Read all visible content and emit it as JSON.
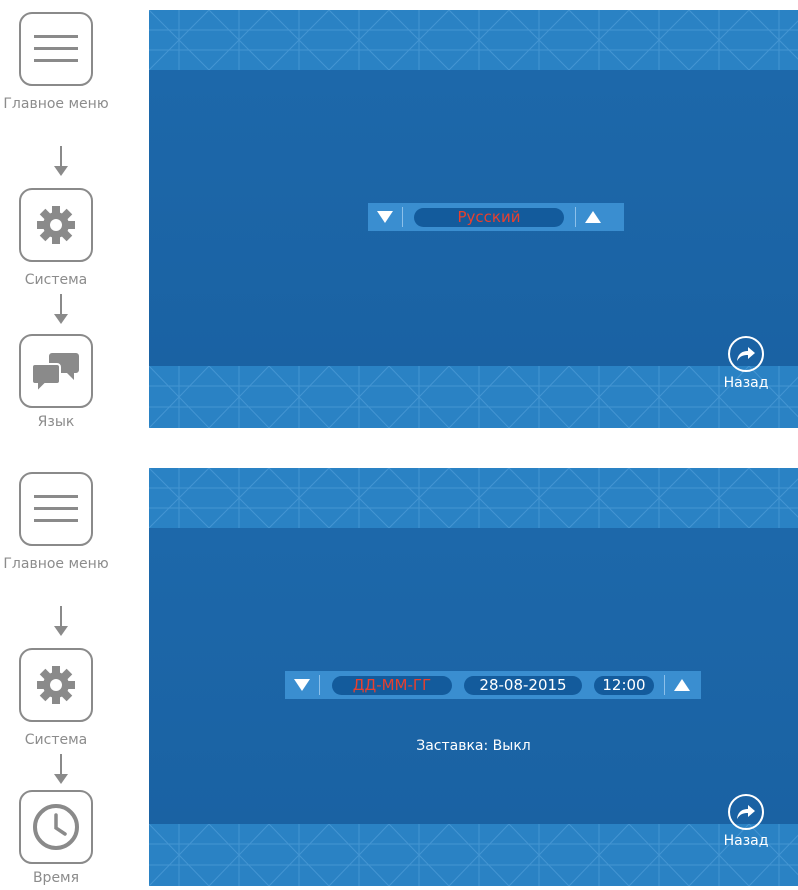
{
  "panels": [
    {
      "nav": [
        {
          "icon": "menu-icon",
          "label": "Главное меню"
        },
        {
          "icon": "gear-icon",
          "label": "Система"
        },
        {
          "icon": "chat-icon",
          "label": "Язык"
        }
      ],
      "screen": {
        "options": [
          {
            "text": "Русский",
            "active": true
          }
        ],
        "status": "",
        "back_label": "Назад"
      }
    },
    {
      "nav": [
        {
          "icon": "menu-icon",
          "label": "Главное меню"
        },
        {
          "icon": "gear-icon",
          "label": "Система"
        },
        {
          "icon": "clock-icon",
          "label": "Время"
        }
      ],
      "screen": {
        "options": [
          {
            "text": "ДД-ММ-ГГ",
            "active": true
          },
          {
            "text": "28-08-2015",
            "active": false
          },
          {
            "text": "12:00",
            "active": false
          }
        ],
        "status": "Заставка: Выкл",
        "back_label": "Назад"
      }
    }
  ],
  "colors": {
    "screen_bg": "#1c6aae",
    "band": "#2a82c4",
    "active_text": "#e8402e",
    "nav_gray": "#8a8a8a"
  }
}
